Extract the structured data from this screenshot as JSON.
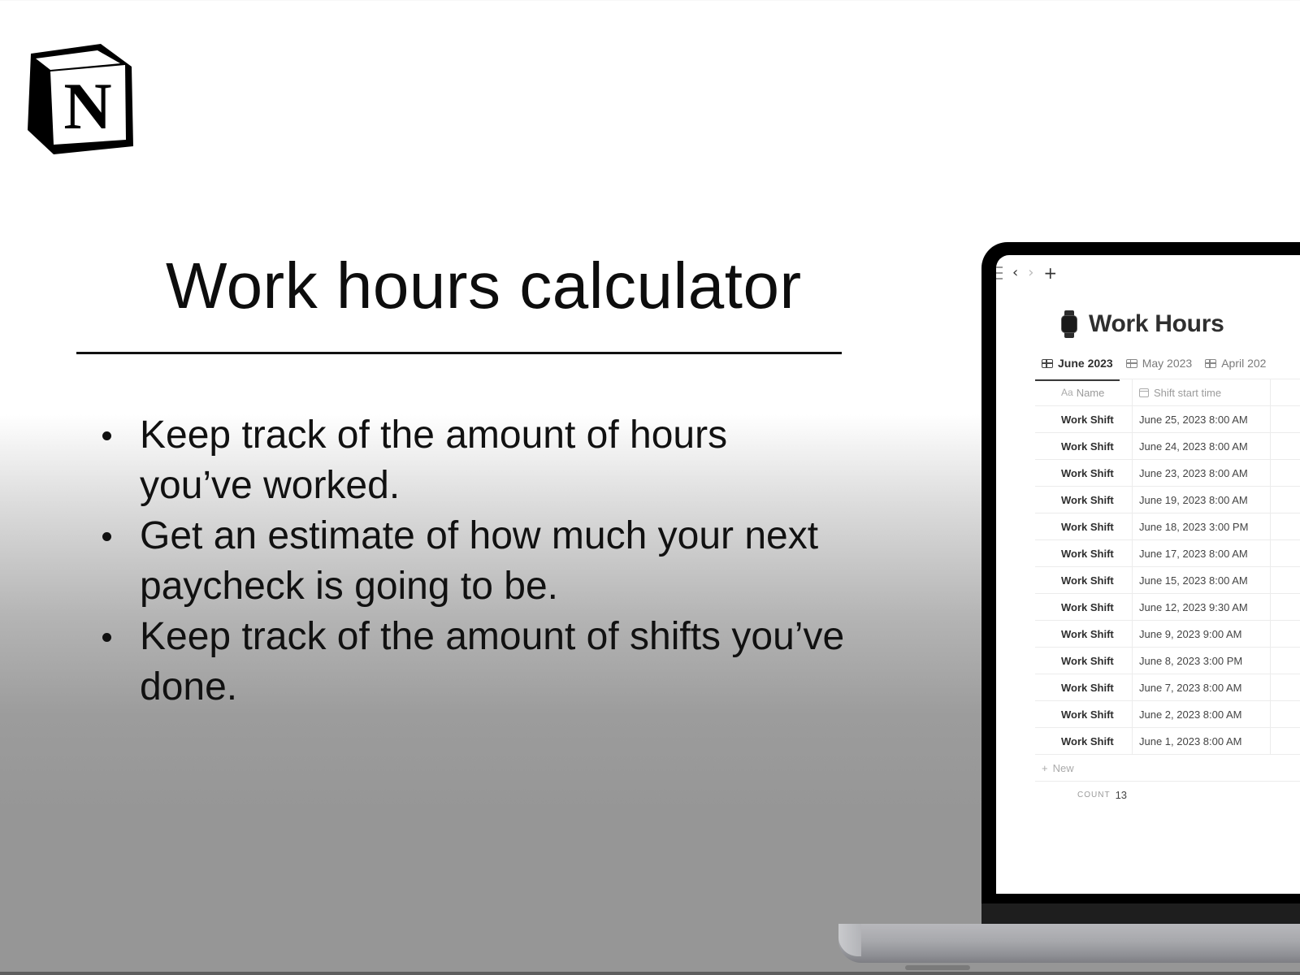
{
  "brand": {
    "logo": "notion-logo-icon"
  },
  "headline": "Work hours calculator",
  "features": [
    "Keep track of the amount of hours you’ve worked.",
    "Get an estimate of how much your next paycheck is going to be.",
    "Keep track of the amount of shifts you’ve done."
  ],
  "app": {
    "topbar": {
      "menu_icon": "sidebar-menu-icon",
      "back": "‹",
      "forward": "›",
      "new": "+"
    },
    "page": {
      "icon": "watch-icon",
      "title": "Work Hours",
      "tabs": [
        {
          "label": "June 2023",
          "active": true
        },
        {
          "label": "May 2023",
          "active": false
        },
        {
          "label": "April 202",
          "active": false
        }
      ],
      "table": {
        "columns": [
          {
            "prefix": "Aa",
            "label": "Name"
          },
          {
            "icon": "calendar-icon",
            "label": "Shift start time"
          }
        ],
        "rows": [
          {
            "name": "Work Shift",
            "start": "June 25, 2023 8:00 AM"
          },
          {
            "name": "Work Shift",
            "start": "June 24, 2023 8:00 AM"
          },
          {
            "name": "Work Shift",
            "start": "June 23, 2023 8:00 AM"
          },
          {
            "name": "Work Shift",
            "start": "June 19, 2023 8:00 AM"
          },
          {
            "name": "Work Shift",
            "start": "June 18, 2023 3:00 PM"
          },
          {
            "name": "Work Shift",
            "start": "June 17, 2023 8:00 AM"
          },
          {
            "name": "Work Shift",
            "start": "June 15, 2023 8:00 AM"
          },
          {
            "name": "Work Shift",
            "start": "June 12, 2023 9:30 AM"
          },
          {
            "name": "Work Shift",
            "start": "June 9, 2023 9:00 AM"
          },
          {
            "name": "Work Shift",
            "start": "June 8, 2023 3:00 PM"
          },
          {
            "name": "Work Shift",
            "start": "June 7, 2023 8:00 AM"
          },
          {
            "name": "Work Shift",
            "start": "June 2, 2023 8:00 AM"
          },
          {
            "name": "Work Shift",
            "start": "June 1, 2023 8:00 AM"
          }
        ],
        "new_label": "New",
        "new_icon": "+",
        "count_label": "COUNT",
        "count_value": "13"
      }
    }
  }
}
